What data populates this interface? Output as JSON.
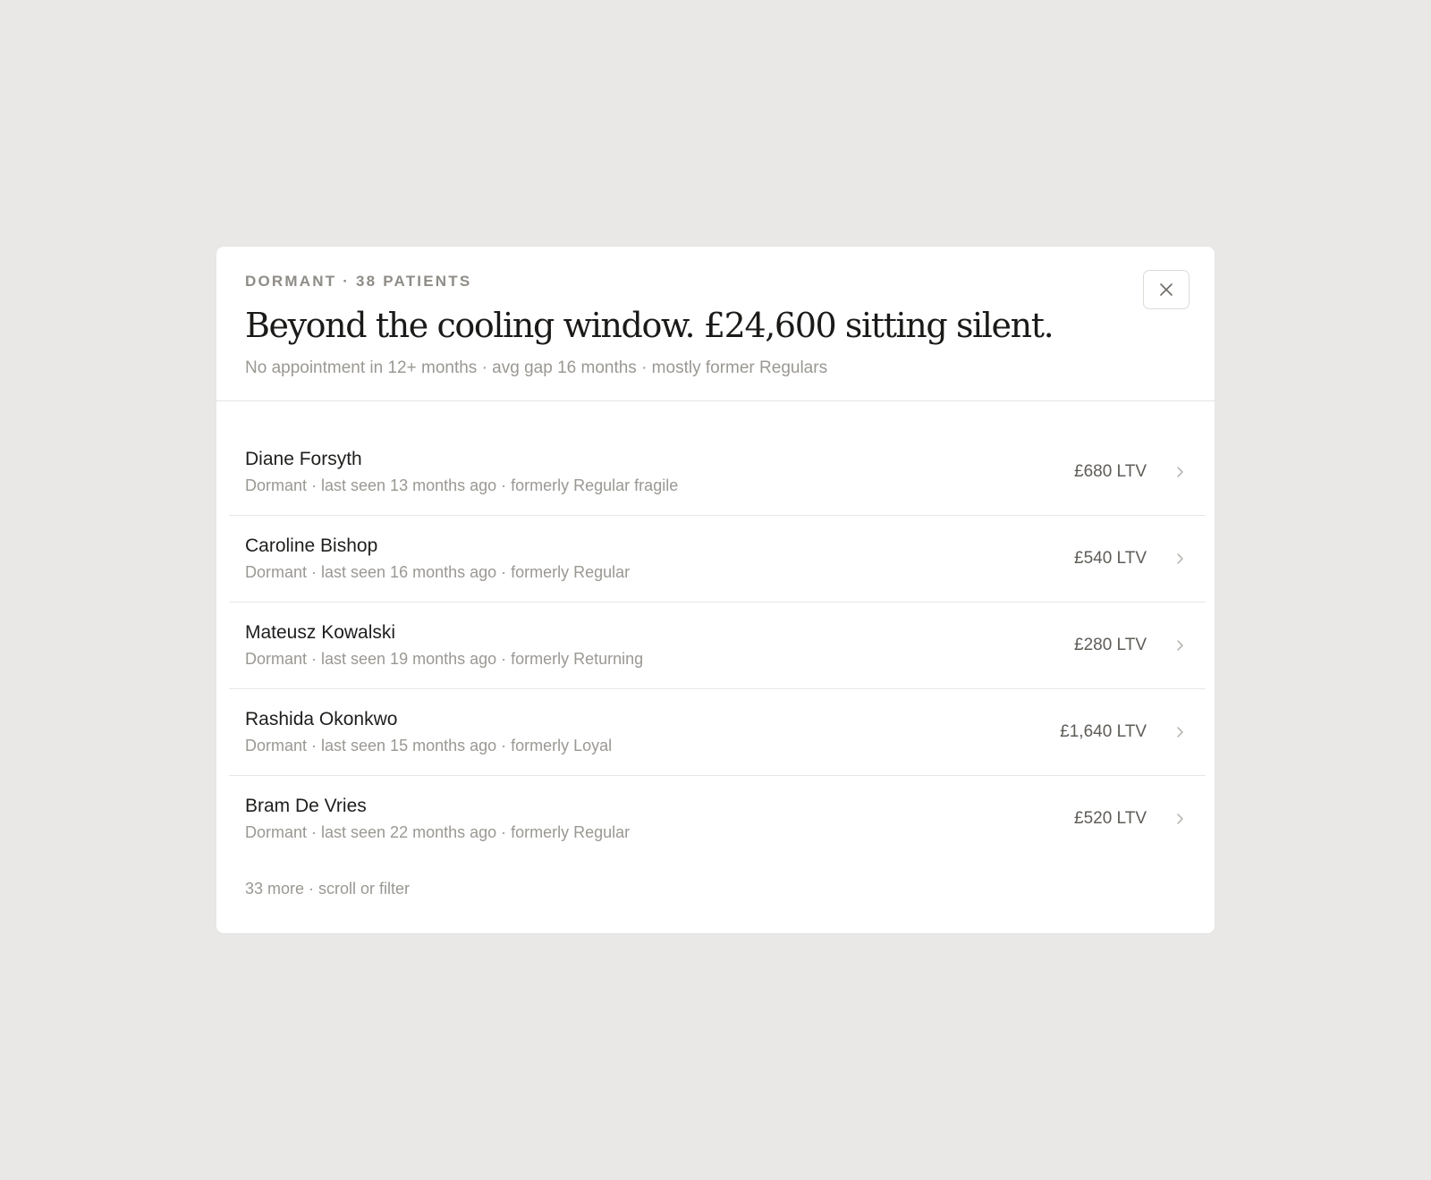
{
  "modal": {
    "eyebrow": "DORMANT · 38 PATIENTS",
    "title": "Beyond the cooling window. £24,600 sitting silent.",
    "subtitle": "No appointment in 12+ months · avg gap 16 months · mostly former Regulars",
    "close_icon": "close-icon"
  },
  "patients": [
    {
      "name": "Diane Forsyth",
      "meta": "Dormant · last seen 13 months ago · formerly Regular fragile",
      "ltv": "£680 LTV"
    },
    {
      "name": "Caroline Bishop",
      "meta": "Dormant · last seen 16 months ago · formerly Regular",
      "ltv": "£540 LTV"
    },
    {
      "name": "Mateusz Kowalski",
      "meta": "Dormant · last seen 19 months ago · formerly Returning",
      "ltv": "£280 LTV"
    },
    {
      "name": "Rashida Okonkwo",
      "meta": "Dormant · last seen 15 months ago · formerly Loyal",
      "ltv": "£1,640 LTV"
    },
    {
      "name": "Bram De Vries",
      "meta": "Dormant · last seen 22 months ago · formerly Regular",
      "ltv": "£520 LTV"
    }
  ],
  "footer": {
    "more_note": "33 more · scroll or filter"
  },
  "colors": {
    "background": "#e9e8e6",
    "panel": "#ffffff",
    "text_primary": "#1b1a18",
    "text_muted": "#9b9893",
    "divider": "#e6e4e1"
  },
  "icons": {
    "row_chevron": "chevron-right-icon"
  }
}
